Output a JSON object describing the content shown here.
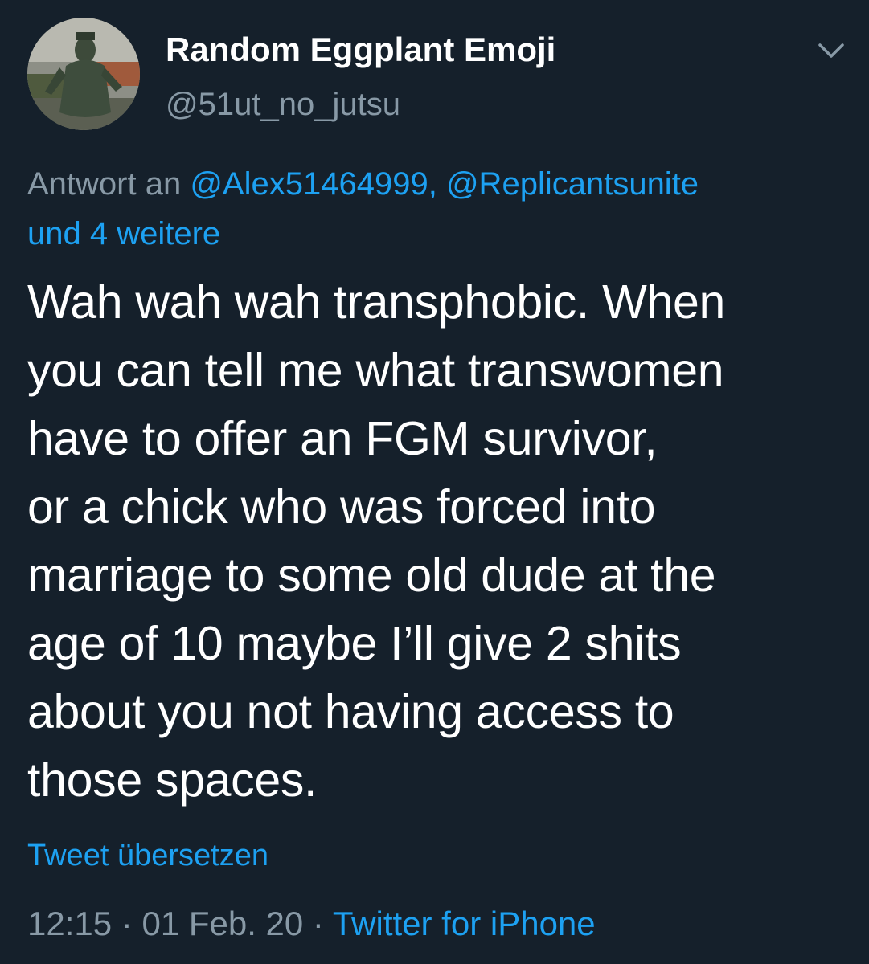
{
  "author": {
    "display_name": "Random Eggplant Emoji",
    "handle": "@51ut_no_jutsu"
  },
  "reply": {
    "prefix": "Antwort an ",
    "mention_1": "@Alex51464999,",
    "separator": " ",
    "mention_2": "@Replicantsunite",
    "more": "und 4 weitere"
  },
  "tweet": {
    "lines": [
      "Wah wah wah transphobic. When",
      "you can tell me what transwomen",
      "have to offer an FGM survivor,",
      "or a chick who was forced into",
      "marriage to some old dude at the",
      "age of 10 maybe I’ll give 2 shits",
      "about you not having access to",
      "those spaces."
    ]
  },
  "translate_label": "Tweet übersetzen",
  "meta": {
    "time": "12:15",
    "dot_1": " · ",
    "date": "01 Feb. 20",
    "dot_2": " · ",
    "source": "Twitter for iPhone"
  },
  "icons": {
    "menu": "chevron-down-icon"
  },
  "colors": {
    "background": "#15202b",
    "primary_text": "#ffffff",
    "secondary_text": "#8899a6",
    "link": "#1da1f2"
  }
}
